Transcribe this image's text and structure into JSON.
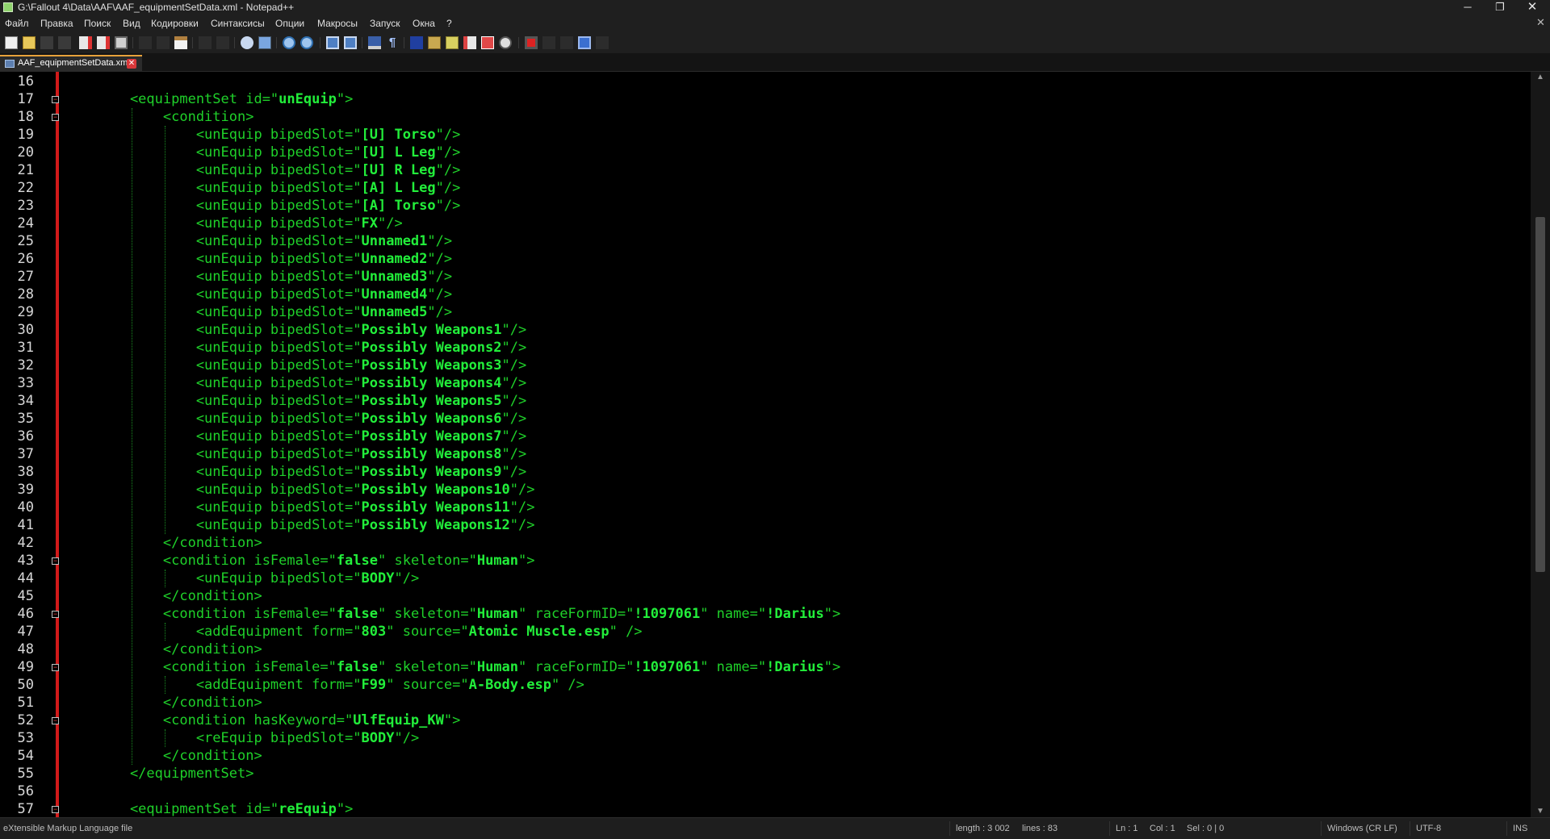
{
  "window": {
    "title": "G:\\Fallout 4\\Data\\AAF\\AAF_equipmentSetData.xml - Notepad++",
    "minimize": "─",
    "maximize": "❐",
    "close": "✕"
  },
  "menu": [
    "Файл",
    "Правка",
    "Поиск",
    "Вид",
    "Кодировки",
    "Синтаксисы",
    "Опции",
    "Макросы",
    "Запуск",
    "Окна",
    "?"
  ],
  "menu_close": "✕",
  "toolbar_icons": [
    "new-file-icon",
    "open-file-icon",
    "save-icon",
    "save-all-icon",
    "close-icon",
    "close-all-icon",
    "print-icon",
    "cut-icon",
    "copy-icon",
    "paste-icon",
    "undo-icon",
    "redo-icon",
    "find-icon",
    "replace-icon",
    "zoom-in-icon",
    "zoom-out-icon",
    "sync-vertical-icon",
    "sync-horizontal-icon",
    "word-wrap-icon",
    "show-all-chars-icon",
    "indent-guide-icon",
    "doc-map-icon",
    "function-list-icon",
    "folder-workspace-icon",
    "doc-list-icon",
    "monitor-icon",
    "record-macro-icon",
    "stop-record-icon",
    "play-macro-icon",
    "run-macro-multiple-icon",
    "save-macro-icon"
  ],
  "tab": {
    "label": "AAF_equipmentSetData.xml",
    "close": "✕"
  },
  "editor": {
    "line_numbers": [
      "16",
      "17",
      "18",
      "19",
      "20",
      "21",
      "22",
      "23",
      "24",
      "25",
      "26",
      "27",
      "28",
      "29",
      "30",
      "31",
      "32",
      "33",
      "34",
      "35",
      "36",
      "37",
      "38",
      "39",
      "40",
      "41",
      "42",
      "43",
      "44",
      "45",
      "46",
      "47",
      "48",
      "49",
      "50",
      "51",
      "52",
      "53",
      "54",
      "55",
      "56",
      "57"
    ],
    "lines": [
      [],
      [
        [
          "t",
          "    <equipmentSet id=\""
        ],
        [
          "v",
          "unEquip"
        ],
        [
          "t",
          "\">"
        ]
      ],
      [
        [
          "t",
          "        <condition>"
        ]
      ],
      [
        [
          "t",
          "            <unEquip bipedSlot=\""
        ],
        [
          "v",
          "[U] Torso"
        ],
        [
          "t",
          "\"/>"
        ]
      ],
      [
        [
          "t",
          "            <unEquip bipedSlot=\""
        ],
        [
          "v",
          "[U] L Leg"
        ],
        [
          "t",
          "\"/>"
        ]
      ],
      [
        [
          "t",
          "            <unEquip bipedSlot=\""
        ],
        [
          "v",
          "[U] R Leg"
        ],
        [
          "t",
          "\"/>"
        ]
      ],
      [
        [
          "t",
          "            <unEquip bipedSlot=\""
        ],
        [
          "v",
          "[A] L Leg"
        ],
        [
          "t",
          "\"/>"
        ]
      ],
      [
        [
          "t",
          "            <unEquip bipedSlot=\""
        ],
        [
          "v",
          "[A] Torso"
        ],
        [
          "t",
          "\"/>"
        ]
      ],
      [
        [
          "t",
          "            <unEquip bipedSlot=\""
        ],
        [
          "v",
          "FX"
        ],
        [
          "t",
          "\"/>"
        ]
      ],
      [
        [
          "t",
          "            <unEquip bipedSlot=\""
        ],
        [
          "v",
          "Unnamed1"
        ],
        [
          "t",
          "\"/>"
        ]
      ],
      [
        [
          "t",
          "            <unEquip bipedSlot=\""
        ],
        [
          "v",
          "Unnamed2"
        ],
        [
          "t",
          "\"/>"
        ]
      ],
      [
        [
          "t",
          "            <unEquip bipedSlot=\""
        ],
        [
          "v",
          "Unnamed3"
        ],
        [
          "t",
          "\"/>"
        ]
      ],
      [
        [
          "t",
          "            <unEquip bipedSlot=\""
        ],
        [
          "v",
          "Unnamed4"
        ],
        [
          "t",
          "\"/>"
        ]
      ],
      [
        [
          "t",
          "            <unEquip bipedSlot=\""
        ],
        [
          "v",
          "Unnamed5"
        ],
        [
          "t",
          "\"/>"
        ]
      ],
      [
        [
          "t",
          "            <unEquip bipedSlot=\""
        ],
        [
          "v",
          "Possibly Weapons1"
        ],
        [
          "t",
          "\"/>"
        ]
      ],
      [
        [
          "t",
          "            <unEquip bipedSlot=\""
        ],
        [
          "v",
          "Possibly Weapons2"
        ],
        [
          "t",
          "\"/>"
        ]
      ],
      [
        [
          "t",
          "            <unEquip bipedSlot=\""
        ],
        [
          "v",
          "Possibly Weapons3"
        ],
        [
          "t",
          "\"/>"
        ]
      ],
      [
        [
          "t",
          "            <unEquip bipedSlot=\""
        ],
        [
          "v",
          "Possibly Weapons4"
        ],
        [
          "t",
          "\"/>"
        ]
      ],
      [
        [
          "t",
          "            <unEquip bipedSlot=\""
        ],
        [
          "v",
          "Possibly Weapons5"
        ],
        [
          "t",
          "\"/>"
        ]
      ],
      [
        [
          "t",
          "            <unEquip bipedSlot=\""
        ],
        [
          "v",
          "Possibly Weapons6"
        ],
        [
          "t",
          "\"/>"
        ]
      ],
      [
        [
          "t",
          "            <unEquip bipedSlot=\""
        ],
        [
          "v",
          "Possibly Weapons7"
        ],
        [
          "t",
          "\"/>"
        ]
      ],
      [
        [
          "t",
          "            <unEquip bipedSlot=\""
        ],
        [
          "v",
          "Possibly Weapons8"
        ],
        [
          "t",
          "\"/>"
        ]
      ],
      [
        [
          "t",
          "            <unEquip bipedSlot=\""
        ],
        [
          "v",
          "Possibly Weapons9"
        ],
        [
          "t",
          "\"/>"
        ]
      ],
      [
        [
          "t",
          "            <unEquip bipedSlot=\""
        ],
        [
          "v",
          "Possibly Weapons10"
        ],
        [
          "t",
          "\"/>"
        ]
      ],
      [
        [
          "t",
          "            <unEquip bipedSlot=\""
        ],
        [
          "v",
          "Possibly Weapons11"
        ],
        [
          "t",
          "\"/>"
        ]
      ],
      [
        [
          "t",
          "            <unEquip bipedSlot=\""
        ],
        [
          "v",
          "Possibly Weapons12"
        ],
        [
          "t",
          "\"/>"
        ]
      ],
      [
        [
          "t",
          "        </condition>"
        ]
      ],
      [
        [
          "t",
          "        <condition isFemale=\""
        ],
        [
          "v",
          "false"
        ],
        [
          "t",
          "\" skeleton=\""
        ],
        [
          "v",
          "Human"
        ],
        [
          "t",
          "\">"
        ]
      ],
      [
        [
          "t",
          "            <unEquip bipedSlot=\""
        ],
        [
          "v",
          "BODY"
        ],
        [
          "t",
          "\"/>"
        ]
      ],
      [
        [
          "t",
          "        </condition>"
        ]
      ],
      [
        [
          "t",
          "        <condition isFemale=\""
        ],
        [
          "v",
          "false"
        ],
        [
          "t",
          "\" skeleton=\""
        ],
        [
          "v",
          "Human"
        ],
        [
          "t",
          "\" raceFormID=\""
        ],
        [
          "v",
          "!1097061"
        ],
        [
          "t",
          "\" name=\""
        ],
        [
          "v",
          "!Darius"
        ],
        [
          "t",
          "\">"
        ]
      ],
      [
        [
          "t",
          "            <addEquipment form=\""
        ],
        [
          "v",
          "803"
        ],
        [
          "t",
          "\" source=\""
        ],
        [
          "v",
          "Atomic Muscle.esp"
        ],
        [
          "t",
          "\" />"
        ]
      ],
      [
        [
          "t",
          "        </condition>"
        ]
      ],
      [
        [
          "t",
          "        <condition isFemale=\""
        ],
        [
          "v",
          "false"
        ],
        [
          "t",
          "\" skeleton=\""
        ],
        [
          "v",
          "Human"
        ],
        [
          "t",
          "\" raceFormID=\""
        ],
        [
          "v",
          "!1097061"
        ],
        [
          "t",
          "\" name=\""
        ],
        [
          "v",
          "!Darius"
        ],
        [
          "t",
          "\">"
        ]
      ],
      [
        [
          "t",
          "            <addEquipment form=\""
        ],
        [
          "v",
          "F99"
        ],
        [
          "t",
          "\" source=\""
        ],
        [
          "v",
          "A-Body.esp"
        ],
        [
          "t",
          "\" />"
        ]
      ],
      [
        [
          "t",
          "        </condition>"
        ]
      ],
      [
        [
          "t",
          "        <condition hasKeyword=\""
        ],
        [
          "v",
          "UlfEquip_KW"
        ],
        [
          "t",
          "\">"
        ]
      ],
      [
        [
          "t",
          "            <reEquip bipedSlot=\""
        ],
        [
          "v",
          "BODY"
        ],
        [
          "t",
          "\"/>"
        ]
      ],
      [
        [
          "t",
          "        </condition>"
        ]
      ],
      [
        [
          "t",
          "    </equipmentSet>"
        ]
      ],
      [],
      [
        [
          "t",
          "    <equipmentSet id=\""
        ],
        [
          "v",
          "reEquip"
        ],
        [
          "t",
          "\">"
        ]
      ]
    ],
    "fold_markers": [
      "17",
      "18",
      "43",
      "46",
      "49",
      "52",
      "57"
    ]
  },
  "status": {
    "file_type": "eXtensible Markup Language file",
    "length": "length : 3 002",
    "lines": "lines : 83",
    "ln": "Ln : 1",
    "col": "Col : 1",
    "sel": "Sel : 0 | 0",
    "eol": "Windows (CR LF)",
    "encoding": "UTF-8",
    "mode": "INS"
  },
  "colors": {
    "tag": "#1fd12a",
    "value": "#22ee3a",
    "fold_bar": "#d11a1a",
    "tab_accent": "#e8a23a"
  }
}
